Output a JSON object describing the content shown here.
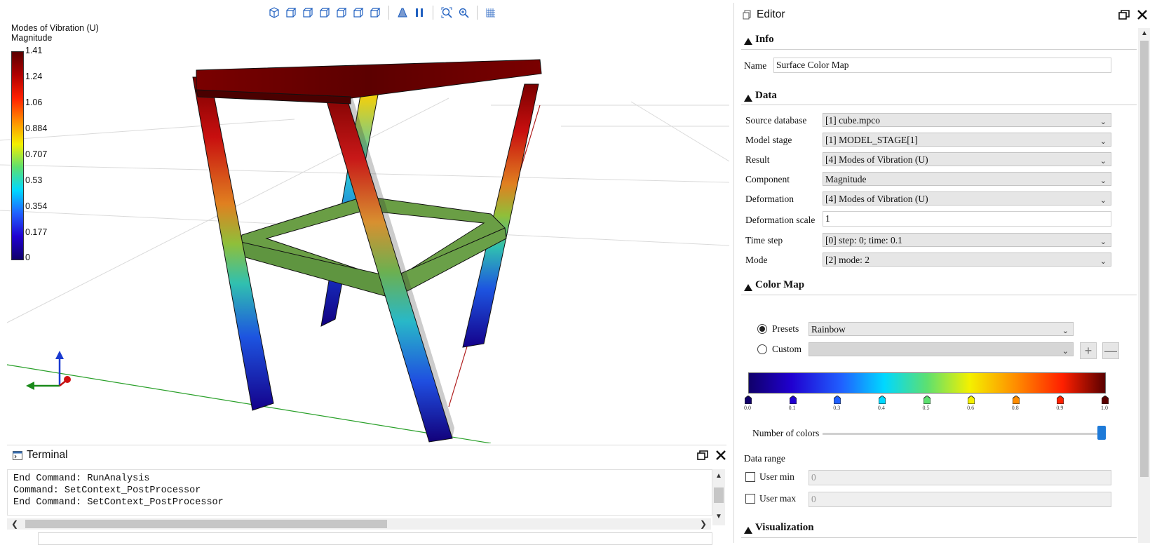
{
  "viewport": {
    "legend": {
      "title_line1": "Modes of Vibration (U)",
      "title_line2": "Magnitude",
      "ticks": [
        "1.41",
        "1.24",
        "1.06",
        "0.884",
        "0.707",
        "0.53",
        "0.354",
        "0.177",
        "0"
      ]
    },
    "toolbar_icons": [
      "view-iso-icon",
      "view-front-icon",
      "view-back-icon",
      "view-left-icon",
      "view-right-icon",
      "view-top-icon",
      "view-bottom-icon",
      "perspective-icon",
      "parallel-icon",
      "zoom-fit-icon",
      "zoom-region-icon",
      "grid-icon"
    ]
  },
  "terminal": {
    "title": "Terminal",
    "lines": [
      "End Command: RunAnalysis",
      "Command: SetContext_PostProcessor",
      "End Command: SetContext_PostProcessor"
    ]
  },
  "editor": {
    "title": "Editor",
    "info": {
      "header": "Info",
      "name_label": "Name",
      "name_value": "Surface Color Map"
    },
    "data": {
      "header": "Data",
      "rows": [
        {
          "label": "Source database",
          "value": "[1] cube.mpco"
        },
        {
          "label": "Model stage",
          "value": "[1] MODEL_STAGE[1]"
        },
        {
          "label": "Result",
          "value": "[4] Modes of Vibration (U)"
        },
        {
          "label": "Component",
          "value": "Magnitude"
        },
        {
          "label": "Deformation",
          "value": "[4] Modes of Vibration (U)"
        }
      ],
      "scale_label": "Deformation scale",
      "scale_value": "1",
      "rows2": [
        {
          "label": "Time step",
          "value": "[0] step: 0; time: 0.1"
        },
        {
          "label": "Mode",
          "value": "[2] mode: 2"
        }
      ]
    },
    "colormap": {
      "header": "Color Map",
      "presets_label": "Presets",
      "presets_value": "Rainbow",
      "custom_label": "Custom",
      "stops": [
        "0.0",
        "0.1",
        "0.3",
        "0.4",
        "0.5",
        "0.6",
        "0.8",
        "0.9",
        "1.0"
      ],
      "stop_colors": [
        "#10006a",
        "#2000d0",
        "#2060ff",
        "#00d8ff",
        "#5de070",
        "#f4f000",
        "#ff8c00",
        "#ff2000",
        "#5a0000"
      ],
      "num_colors_label": "Number of colors",
      "num_colors_fraction": 1.0,
      "data_range_label": "Data range",
      "user_min_label": "User min",
      "user_min_value": "0",
      "user_max_label": "User max",
      "user_max_value": "0"
    },
    "visualization": {
      "header": "Visualization"
    }
  }
}
